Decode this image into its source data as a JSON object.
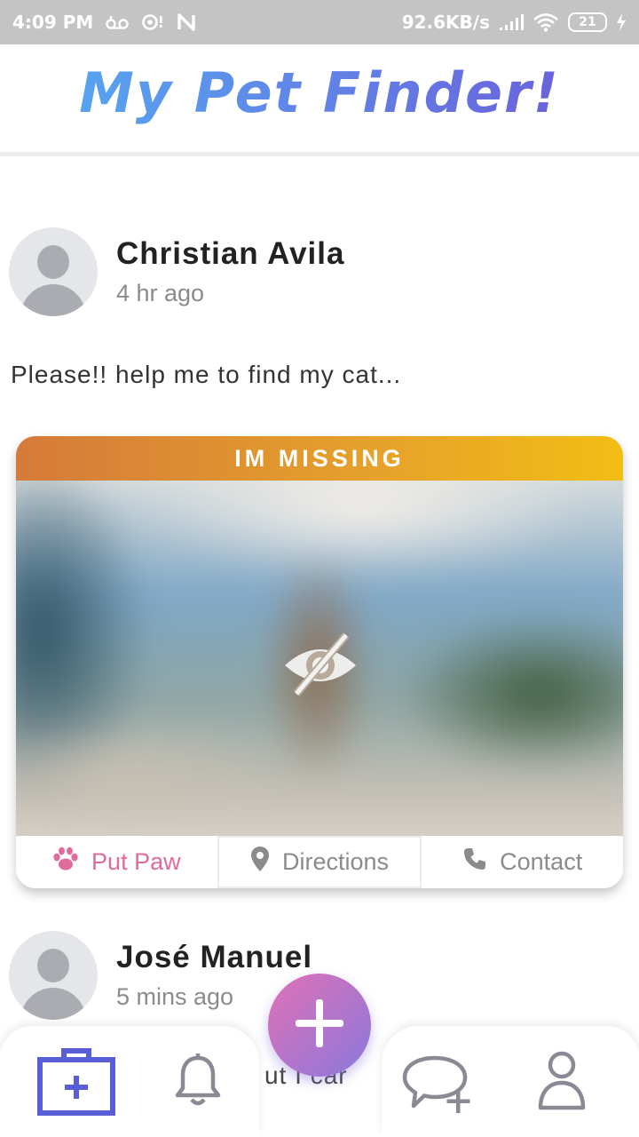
{
  "status_bar": {
    "time": "4:09 PM",
    "speed": "92.6KB/s",
    "battery": "21"
  },
  "header": {
    "title": "My Pet Finder!"
  },
  "posts": [
    {
      "author": "Christian Avila",
      "time": "4 hr ago",
      "text": "Please!! help me to find my cat...",
      "banner": "IM MISSING",
      "actions": {
        "put_paw": "Put Paw",
        "directions": "Directions",
        "contact": "Contact"
      }
    },
    {
      "author": "José Manuel",
      "time": "5 mins ago",
      "text_partial": "ut I car"
    }
  ],
  "colors": {
    "title_gradient_start": "#57a3f0",
    "title_gradient_end": "#6a63dc",
    "banner_start": "#d47a3a",
    "banner_end": "#f4bd14",
    "paw_pink": "#e26a9c",
    "nav_active": "#5a5ed6",
    "nav_inactive": "#8a8a95"
  },
  "icons": {
    "status": [
      "voicemail-icon",
      "camera-notification-icon",
      "n-icon",
      "signal-icon",
      "wifi-icon",
      "battery-icon",
      "charging-icon"
    ],
    "photo": "eye-off-icon",
    "actions": [
      "paw-icon",
      "location-pin-icon",
      "phone-icon"
    ],
    "fab": "plus-icon",
    "nav": [
      "medical-kit-icon",
      "bell-icon",
      "chat-add-icon",
      "user-icon"
    ]
  }
}
